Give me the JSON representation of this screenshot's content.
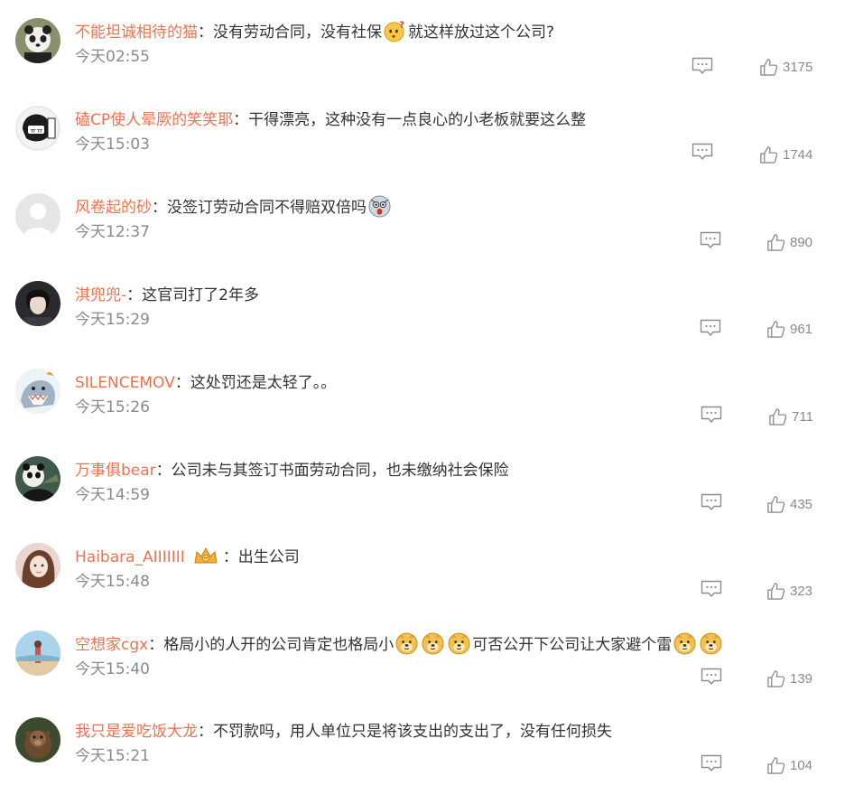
{
  "comments": [
    {
      "username": "不能坦诚相待的猫",
      "colon": "：",
      "text_before": "没有劳动合同，没有社保",
      "emoji": "doubt-emoji",
      "text_after": "就这样放过这个公司?",
      "time": "今天02:55",
      "likes": "3175"
    },
    {
      "username": "磕CP使人晕厥的笑笑耶",
      "colon": "：",
      "text_before": "干得漂亮，这种没有一点良心的小老板就要这么整",
      "time": "今天15:03",
      "likes": "1744"
    },
    {
      "username": "风卷起的砂",
      "colon": "：",
      "text_before": "没签订劳动合同不得赔双倍吗",
      "emoji": "shocked-emoji",
      "time": "今天12:37",
      "likes": "890"
    },
    {
      "username": "淇兜兜-",
      "colon": "：",
      "text_before": "这官司打了2年多",
      "time": "今天15:29",
      "likes": "961"
    },
    {
      "username": "SILENCEMOV",
      "colon": "：",
      "text_before": "这处罚还是太轻了。。",
      "time": "今天15:26",
      "likes": "711"
    },
    {
      "username": "万事俱bear",
      "colon": "：",
      "text_before": "公司未与其签订书面劳动合同，也未缴纳社会保险",
      "time": "今天14:59",
      "likes": "435"
    },
    {
      "username": "Haibara_AIIIIIII",
      "badge": "crown-badge",
      "colon": "：",
      "text_before": "出生公司",
      "time": "今天15:48",
      "likes": "323"
    },
    {
      "username": "空想家cgx",
      "colon": "：",
      "text_before": "格局小的人开的公司肯定也格局小",
      "emoji_group_1": "doge-emoji",
      "text_mid": "可否公开下公司让大家避个雷",
      "emoji_group_2": "doge-emoji",
      "time": "今天15:40",
      "likes": "139"
    },
    {
      "username": "我只是爱吃饭大龙",
      "colon": "：",
      "text_before": "不罚款吗，用人单位只是将该支出的支出了，没有任何损失",
      "time": "今天15:21",
      "likes": "104"
    }
  ],
  "colors": {
    "username": "#eb7350",
    "text": "#333333",
    "meta": "#8a8a8a",
    "icon": "#9a9a9a"
  },
  "icons": {
    "reply": "comment-icon",
    "like": "thumbs-up-icon"
  }
}
